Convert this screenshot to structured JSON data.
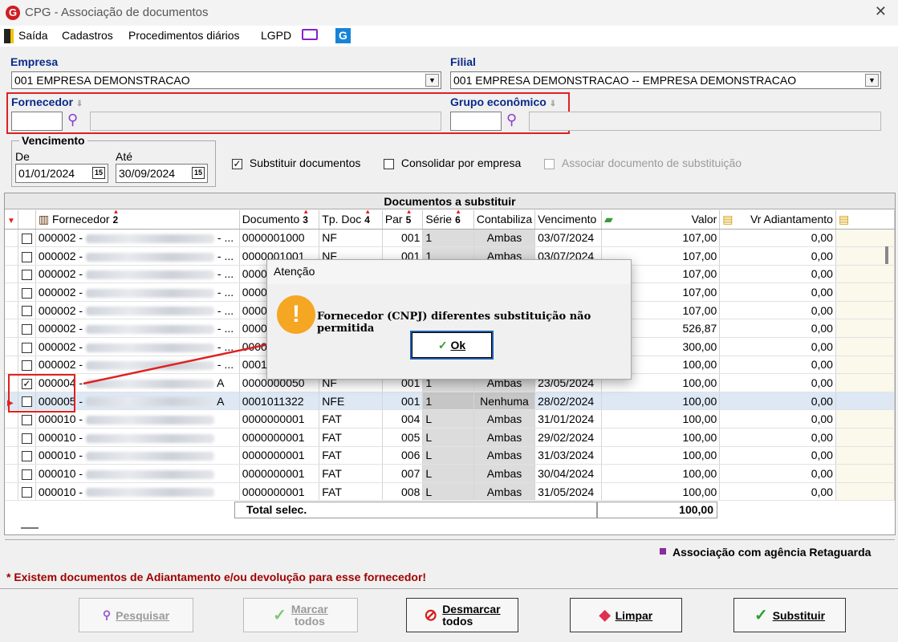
{
  "window": {
    "title": "CPG - Associação de documentos",
    "logo_letter": "G"
  },
  "menu": {
    "items": [
      "Saída",
      "Cadastros",
      "Procedimentos diários",
      "LGPD"
    ]
  },
  "filters": {
    "empresa_label": "Empresa",
    "empresa_value": "001 EMPRESA DEMONSTRACAO",
    "filial_label": "Filial",
    "filial_value": "001 EMPRESA DEMONSTRACAO -- EMPRESA DEMONSTRACAO",
    "fornecedor_label": "Fornecedor",
    "grupo_label": "Grupo econômico",
    "vencimento_label": "Vencimento",
    "de_label": "De",
    "de_value": "01/01/2024",
    "ate_label": "Até",
    "ate_value": "30/09/2024",
    "cal_label": "15",
    "opt_substituir": "Substituir documentos",
    "opt_consolidar": "Consolidar por empresa",
    "opt_associar": "Associar documento de substituição"
  },
  "grid": {
    "caption": "Documentos a substituir",
    "columns": [
      "Fornecedor",
      "Documento",
      "Tp. Doc",
      "Par",
      "Série",
      "Contabiliza",
      "Vencimento",
      "Valor",
      "Vr Adiantamento"
    ],
    "sort_marks": [
      "2",
      "3",
      "4",
      "5",
      "6"
    ],
    "rows": [
      {
        "forn": "000002 -",
        "tail": "- ...",
        "doc": "0000001000",
        "tp": "NF",
        "par": "001",
        "serie": "1",
        "cont": "Ambas",
        "venc": "03/07/2024",
        "valor": "107,00",
        "adi": "0,00",
        "checked": false
      },
      {
        "forn": "000002 -",
        "tail": "- ...",
        "doc": "0000001001",
        "tp": "NF",
        "par": "001",
        "serie": "1",
        "cont": "Ambas",
        "venc": "03/07/2024",
        "valor": "107,00",
        "adi": "0,00",
        "checked": false
      },
      {
        "forn": "000002 -",
        "tail": "- ...",
        "doc": "0000",
        "tp": "",
        "par": "",
        "serie": "",
        "cont": "",
        "venc": "",
        "valor": "107,00",
        "adi": "0,00",
        "checked": false
      },
      {
        "forn": "000002 -",
        "tail": "- ...",
        "doc": "0000",
        "tp": "",
        "par": "",
        "serie": "",
        "cont": "",
        "venc": "",
        "valor": "107,00",
        "adi": "0,00",
        "checked": false
      },
      {
        "forn": "000002 -",
        "tail": "- ...",
        "doc": "0000",
        "tp": "",
        "par": "",
        "serie": "",
        "cont": "",
        "venc": "",
        "valor": "107,00",
        "adi": "0,00",
        "checked": false
      },
      {
        "forn": "000002 -",
        "tail": "- ...",
        "doc": "0000",
        "tp": "",
        "par": "",
        "serie": "",
        "cont": "",
        "venc": "",
        "valor": "526,87",
        "adi": "0,00",
        "checked": false
      },
      {
        "forn": "000002 -",
        "tail": "- ...",
        "doc": "0000",
        "tp": "",
        "par": "",
        "serie": "",
        "cont": "",
        "venc": "",
        "valor": "300,00",
        "adi": "0,00",
        "checked": false
      },
      {
        "forn": "000002 -",
        "tail": "- ...",
        "doc": "00010",
        "tp": "",
        "par": "",
        "serie": "",
        "cont": "",
        "venc": "",
        "valor": "100,00",
        "adi": "0,00",
        "checked": false
      },
      {
        "forn": "000004 -",
        "tail": "A",
        "doc": "0000000050",
        "tp": "NF",
        "par": "001",
        "serie": "1",
        "cont": "Ambas",
        "venc": "23/05/2024",
        "valor": "100,00",
        "adi": "0,00",
        "checked": true
      },
      {
        "forn": "000005 -",
        "tail": "A",
        "doc": "0001011322",
        "tp": "NFE",
        "par": "001",
        "serie": "1",
        "cont": "Nenhuma",
        "venc": "28/02/2024",
        "valor": "100,00",
        "adi": "0,00",
        "checked": false,
        "selected": true
      },
      {
        "forn": "000010 -",
        "tail": "",
        "doc": "0000000001",
        "tp": "FAT",
        "par": "004",
        "serie": "L",
        "cont": "Ambas",
        "venc": "31/01/2024",
        "valor": "100,00",
        "adi": "0,00",
        "checked": false
      },
      {
        "forn": "000010 -",
        "tail": "",
        "doc": "0000000001",
        "tp": "FAT",
        "par": "005",
        "serie": "L",
        "cont": "Ambas",
        "venc": "29/02/2024",
        "valor": "100,00",
        "adi": "0,00",
        "checked": false
      },
      {
        "forn": "000010 -",
        "tail": "",
        "doc": "0000000001",
        "tp": "FAT",
        "par": "006",
        "serie": "L",
        "cont": "Ambas",
        "venc": "31/03/2024",
        "valor": "100,00",
        "adi": "0,00",
        "checked": false
      },
      {
        "forn": "000010 -",
        "tail": "",
        "doc": "0000000001",
        "tp": "FAT",
        "par": "007",
        "serie": "L",
        "cont": "Ambas",
        "venc": "30/04/2024",
        "valor": "100,00",
        "adi": "0,00",
        "checked": false
      },
      {
        "forn": "000010 -",
        "tail": "",
        "doc": "0000000001",
        "tp": "FAT",
        "par": "008",
        "serie": "L",
        "cont": "Ambas",
        "venc": "31/05/2024",
        "valor": "100,00",
        "adi": "0,00",
        "checked": false
      }
    ],
    "total_label": "Total selec.",
    "total_value": "100,00"
  },
  "legend": {
    "assoc": "Associação com agência Retaguarda"
  },
  "note": "* Existem documentos de Adiantamento e/ou devolução para esse fornecedor!",
  "dialog": {
    "title": "Atenção",
    "message": "Fornecedor (CNPJ) diferentes substituição não permitida",
    "ok_label": "Ok"
  },
  "buttons": {
    "pesquisar": "Pesquisar",
    "marcar_line1": "Marcar",
    "marcar_line2": "todos",
    "desmarcar_line1": "Desmarcar",
    "desmarcar_line2": "todos",
    "limpar": "Limpar",
    "substituir": "Substituir"
  },
  "colors": {
    "accent": "#0a2a8a",
    "highlight": "#e02020",
    "warning": "#f5a623",
    "note": "#a00000"
  }
}
